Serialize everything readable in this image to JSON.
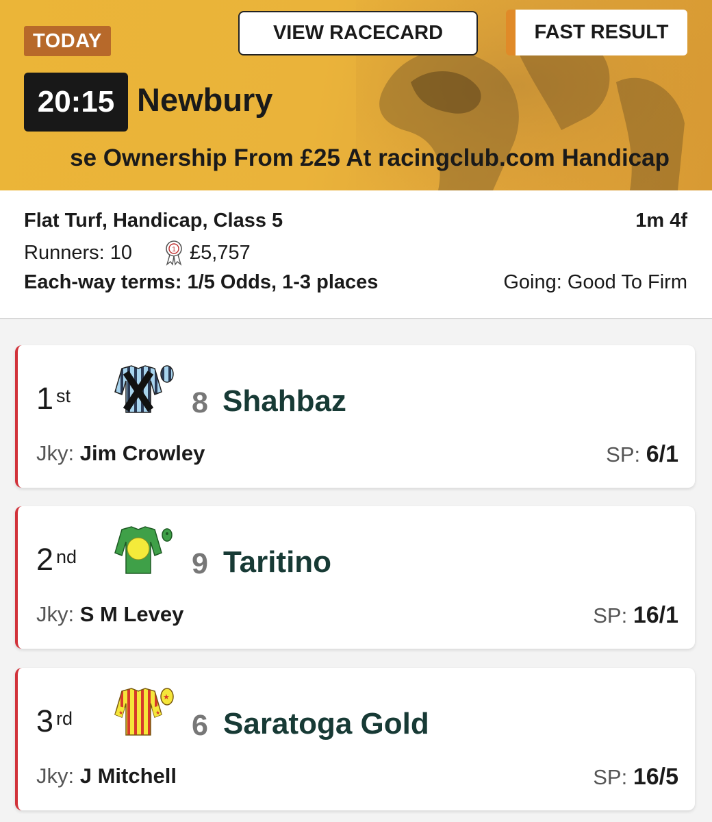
{
  "header": {
    "today_badge": "TODAY",
    "view_racecard_label": "VIEW RACECARD",
    "fast_result_label": "FAST RESULT",
    "time": "20:15",
    "venue": "Newbury",
    "race_title": "se Ownership From £25 At racingclub.com Handicap"
  },
  "info": {
    "race_type": "Flat Turf, Handicap, Class 5",
    "distance": "1m 4f",
    "runners": "Runners: 10",
    "prize": "£5,757",
    "each_way": "Each-way terms: 1/5 Odds, 1-3 places",
    "going": "Going: Good To Firm"
  },
  "results": [
    {
      "pos": "1",
      "suffix": "st",
      "number": "8",
      "name": "Shahbaz",
      "jky_label": "Jky:",
      "jockey": "Jim Crowley",
      "sp_label": "SP:",
      "sp": "6/1"
    },
    {
      "pos": "2",
      "suffix": "nd",
      "number": "9",
      "name": "Taritino",
      "jky_label": "Jky:",
      "jockey": "S M Levey",
      "sp_label": "SP:",
      "sp": "16/1"
    },
    {
      "pos": "3",
      "suffix": "rd",
      "number": "6",
      "name": "Saratoga Gold",
      "jky_label": "Jky:",
      "jockey": "J Mitchell",
      "sp_label": "SP:",
      "sp": "16/5"
    }
  ],
  "colors": {
    "accent_gold": "#ebb538",
    "badge_brown": "#b7692a",
    "winner_stripe": "#d1323a",
    "horse_name": "#173a35"
  }
}
